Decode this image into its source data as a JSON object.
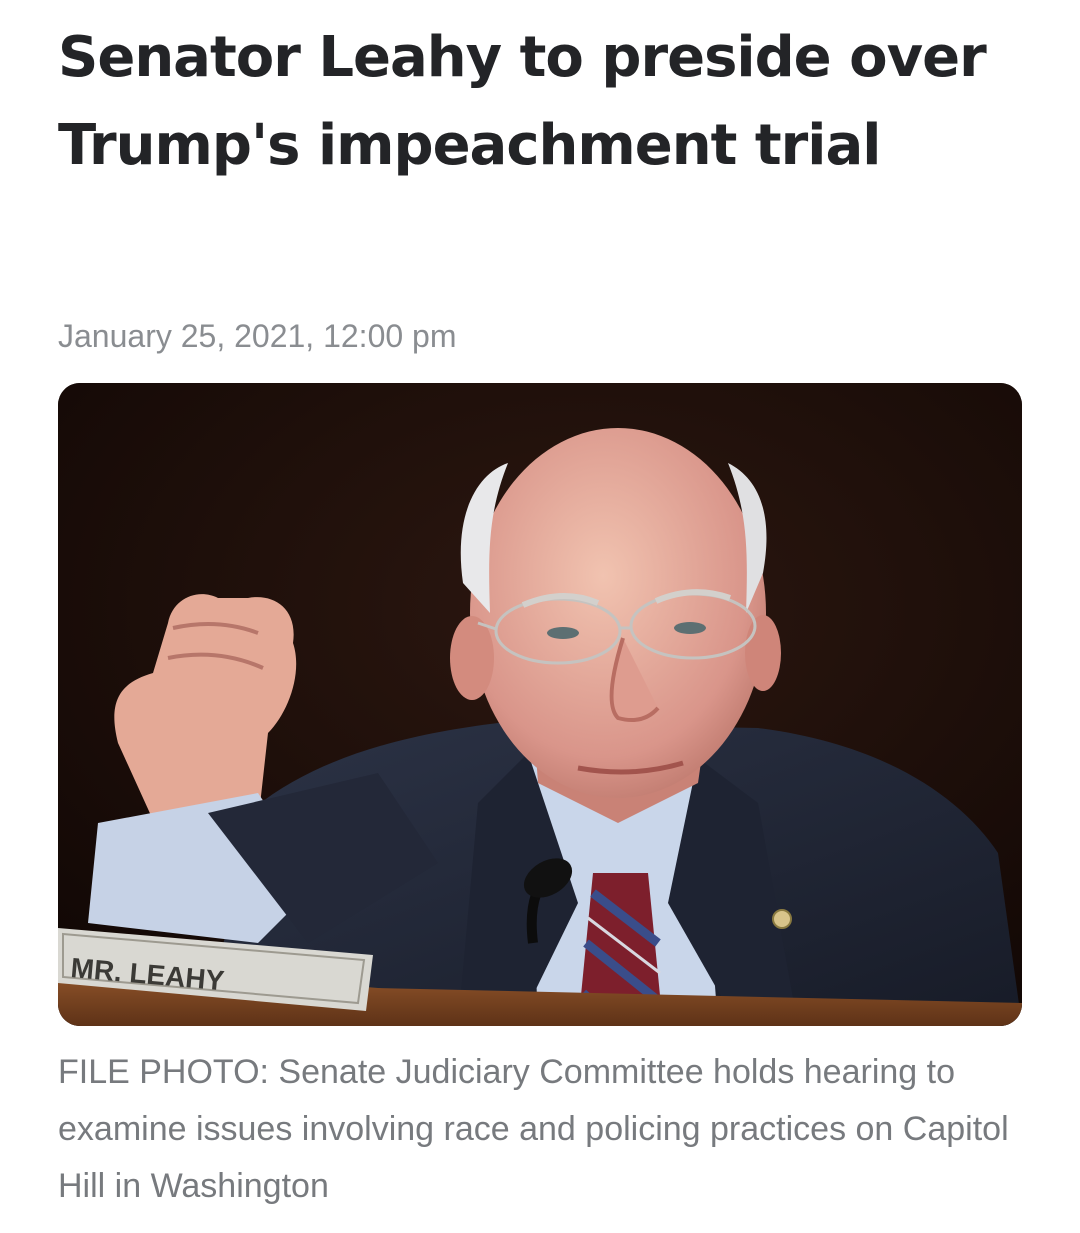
{
  "article": {
    "headline": "Senator Leahy to preside over Trump's impeachment trial",
    "dateline": "January 25, 2021, 12:00 pm",
    "photo": {
      "nameplate_text": "MR. LEAHY"
    },
    "caption": "FILE PHOTO: Senate Judiciary Committee holds hearing to examine issues involving race and policing practices on Capitol Hill in Washington"
  },
  "colors": {
    "headline": "#232427",
    "meta_text": "#8a8d91",
    "caption_text": "#777a7e",
    "photo_background": "#1a0d09"
  }
}
